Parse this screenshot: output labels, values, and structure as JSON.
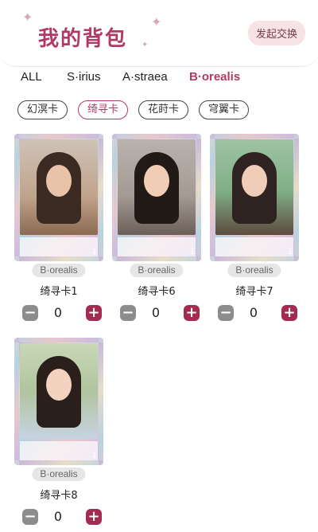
{
  "header": {
    "title": "我的背包",
    "trade_label": "发起交换"
  },
  "tabs": [
    {
      "label": "ALL",
      "active": false
    },
    {
      "label": "S·irius",
      "active": false
    },
    {
      "label": "A·straea",
      "active": false
    },
    {
      "label": "B·orealis",
      "active": true
    }
  ],
  "subtabs": [
    {
      "label": "幻溟卡",
      "active": false
    },
    {
      "label": "绮寻卡",
      "active": true
    },
    {
      "label": "花莳卡",
      "active": false
    },
    {
      "label": "穹翼卡",
      "active": false
    }
  ],
  "cards": [
    {
      "badge": "B·orealis",
      "name": "绮寻卡1",
      "qty": "0",
      "num": "1",
      "minus": "−",
      "plus": "+"
    },
    {
      "badge": "B·orealis",
      "name": "绮寻卡6",
      "qty": "0",
      "num": "1",
      "minus": "−",
      "plus": "+"
    },
    {
      "badge": "B·orealis",
      "name": "绮寻卡7",
      "qty": "0",
      "num": "1",
      "minus": "−",
      "plus": "+"
    },
    {
      "badge": "B·orealis",
      "name": "绮寻卡8",
      "qty": "0",
      "num": "1",
      "minus": "−",
      "plus": "+"
    }
  ],
  "colors": {
    "accent": "#b03a66",
    "plus_button": "#a52a50",
    "minus_button": "#8c8c8c"
  }
}
